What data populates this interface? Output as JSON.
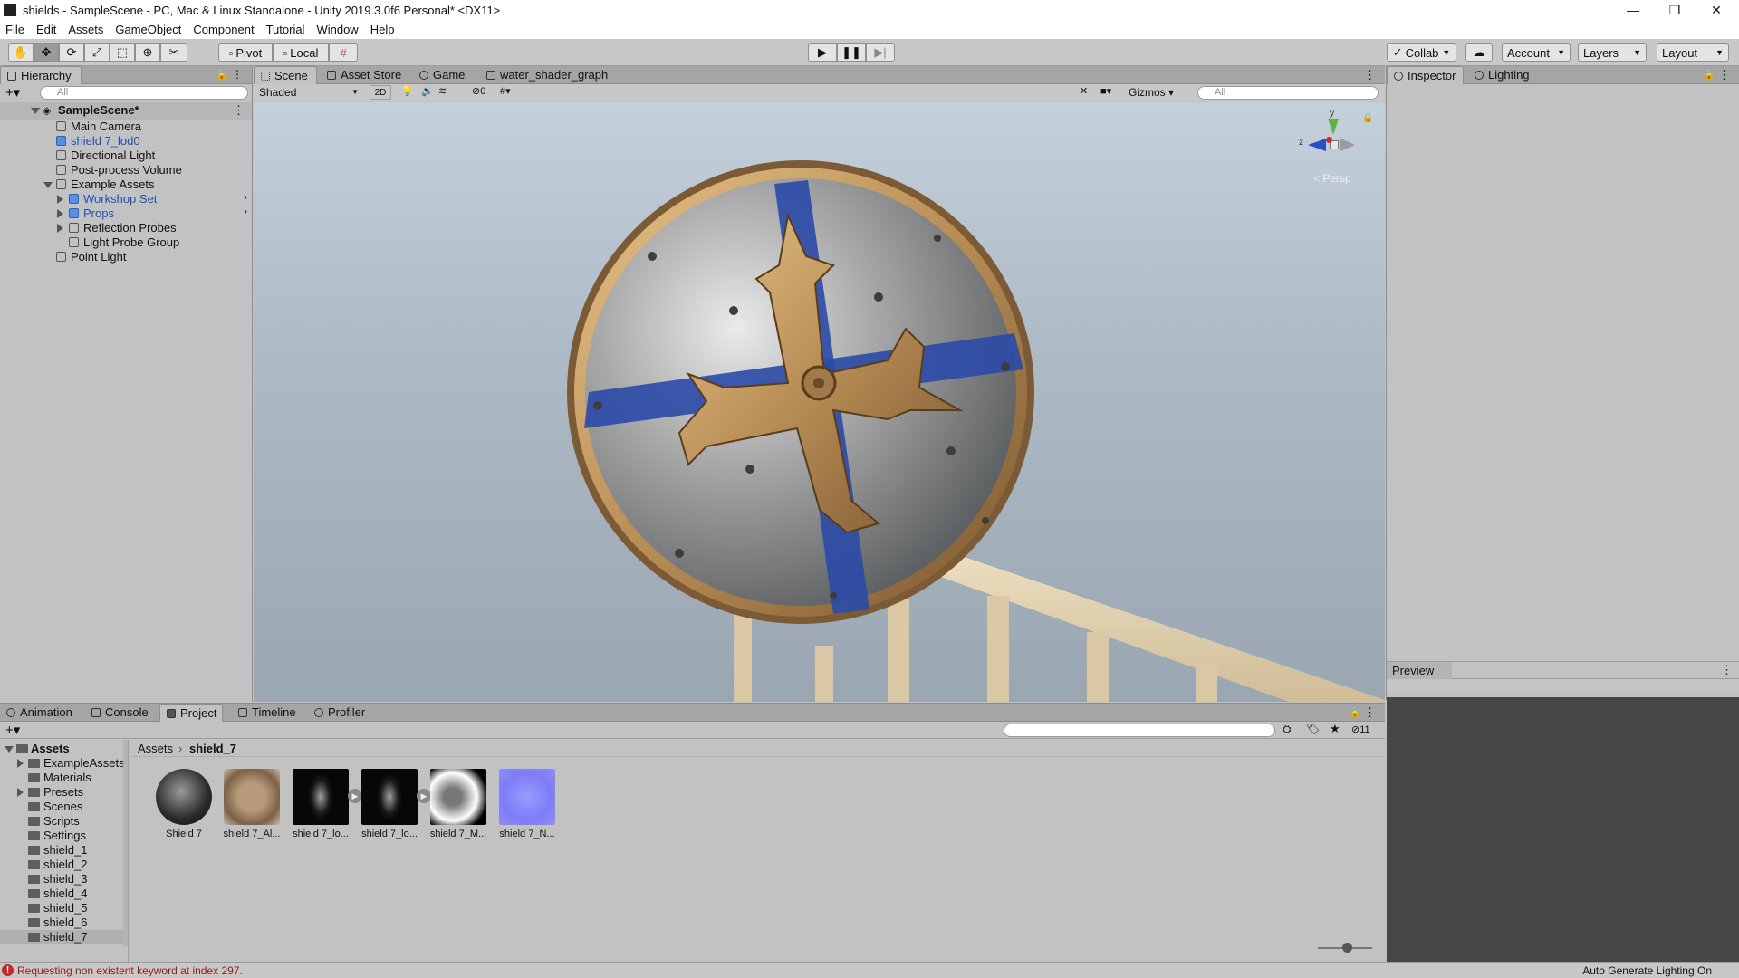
{
  "window": {
    "title": "shields - SampleScene - PC, Mac & Linux Standalone - Unity 2019.3.0f6 Personal* <DX11>",
    "controls": [
      "—",
      "❐",
      "✕"
    ]
  },
  "menu": [
    "File",
    "Edit",
    "Assets",
    "GameObject",
    "Component",
    "Tutorial",
    "Window",
    "Help"
  ],
  "toolbar": {
    "pivot": "Pivot",
    "local": "Local",
    "collab": "Collab",
    "account": "Account",
    "layers": "Layers",
    "layout": "Layout"
  },
  "hierarchy": {
    "tab": "Hierarchy",
    "search_placeholder": "All",
    "scene": "SampleScene*",
    "items": [
      {
        "label": "Main Camera"
      },
      {
        "label": "shield 7_lod0"
      },
      {
        "label": "Directional Light"
      },
      {
        "label": "Post-process Volume"
      },
      {
        "label": "Example Assets"
      },
      {
        "label": "Workshop Set"
      },
      {
        "label": "Props"
      },
      {
        "label": "Reflection Probes"
      },
      {
        "label": "Light Probe Group"
      },
      {
        "label": "Point Light"
      }
    ]
  },
  "scene_view": {
    "tabs": [
      "Scene",
      "Asset Store",
      "Game",
      "water_shader_graph"
    ],
    "shading": "Shaded",
    "mode_2d": "2D",
    "hidden_count": "0",
    "gizmos": "Gizmos",
    "search_placeholder": "All",
    "persp": "< Persp",
    "gizmo_axes": {
      "y": "y",
      "z": "z"
    }
  },
  "inspector": {
    "tabs": [
      "Inspector",
      "Lighting"
    ],
    "preview": "Preview"
  },
  "bottom": {
    "tabs": [
      "Animation",
      "Console",
      "Project",
      "Timeline",
      "Profiler"
    ],
    "breadcrumb": [
      "Assets",
      "shield_7"
    ],
    "hidden_count": "11",
    "folders": [
      {
        "label": "Assets"
      },
      {
        "label": "ExampleAssets"
      },
      {
        "label": "Materials"
      },
      {
        "label": "Presets"
      },
      {
        "label": "Scenes"
      },
      {
        "label": "Scripts"
      },
      {
        "label": "Settings"
      },
      {
        "label": "shield_1"
      },
      {
        "label": "shield_2"
      },
      {
        "label": "shield_3"
      },
      {
        "label": "shield_4"
      },
      {
        "label": "shield_5"
      },
      {
        "label": "shield_6"
      },
      {
        "label": "shield_7"
      }
    ],
    "assets": [
      {
        "label": "Shield 7"
      },
      {
        "label": "shield 7_Al..."
      },
      {
        "label": "shield 7_lo..."
      },
      {
        "label": "shield 7_lo..."
      },
      {
        "label": "shield 7_M..."
      },
      {
        "label": "shield 7_N..."
      }
    ]
  },
  "status": {
    "error": "Requesting non existent keyword at index 297.",
    "lighting": "Auto Generate Lighting On"
  }
}
